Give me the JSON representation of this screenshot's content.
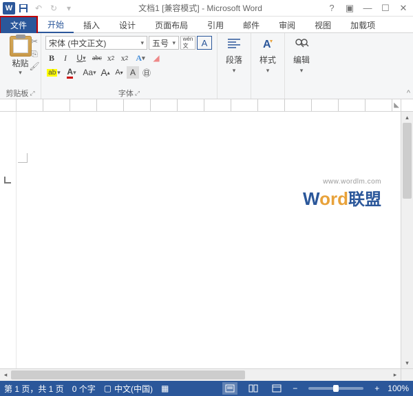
{
  "titlebar": {
    "title": "文档1 [兼容模式] - Microsoft Word"
  },
  "tabs": {
    "file": "文件",
    "home": "开始",
    "insert": "插入",
    "design": "设计",
    "layout": "页面布局",
    "references": "引用",
    "mailings": "邮件",
    "review": "审阅",
    "view": "视图",
    "addins": "加载项"
  },
  "ribbon": {
    "clipboard": {
      "label": "剪贴板",
      "paste": "粘贴"
    },
    "font": {
      "label": "字体",
      "name": "宋体 (中文正文)",
      "size": "五号",
      "phonetic": "wén",
      "bold": "B",
      "italic": "I",
      "underline": "U",
      "strike": "abc",
      "sub": "x₂",
      "sup": "x²",
      "effects": "A",
      "highlight": "ab",
      "color": "A",
      "charborder": "Aa",
      "grow": "A",
      "shrink": "A",
      "clearfmt": "A",
      "circled": "㊕"
    },
    "paragraph": {
      "label": "段落"
    },
    "styles": {
      "label": "样式"
    },
    "editing": {
      "label": "编辑"
    }
  },
  "watermark": {
    "url": "www.wordlm.com",
    "w": "W",
    "ord": "ord",
    "cn": "联盟"
  },
  "status": {
    "page": "第 1 页，共 1 页",
    "words": "0 个字",
    "lang": "中文(中国)",
    "zoom": "100%"
  }
}
